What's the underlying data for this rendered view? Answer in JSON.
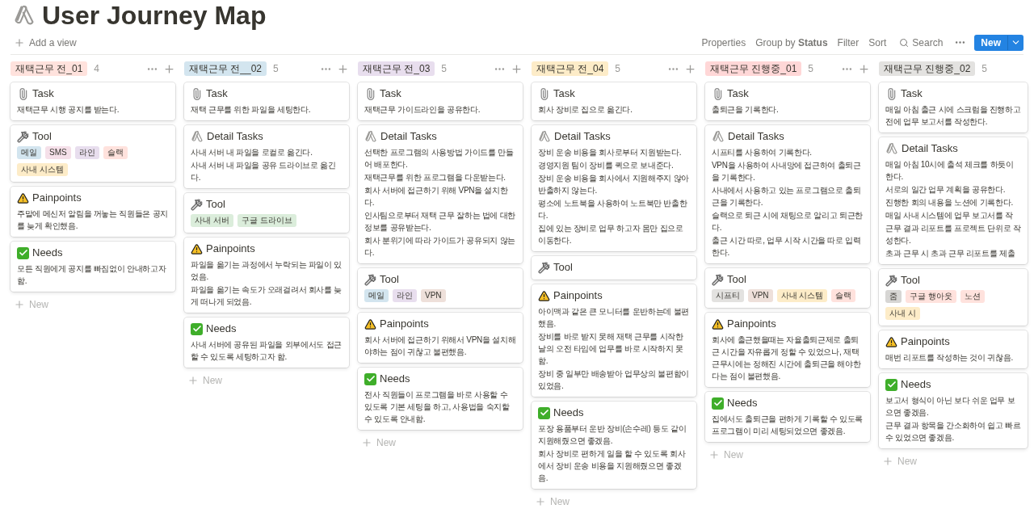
{
  "page": {
    "title": "User Journey Map"
  },
  "toolbar": {
    "add_view": "Add a view",
    "actions": [
      "Properties",
      "Group by **Status**",
      "Filter",
      "Sort"
    ],
    "search": "Search",
    "new_button": "New"
  },
  "columns": [
    {
      "label": "재택근무 전_01",
      "color": "#ffe2dd",
      "count": "4",
      "controls": true,
      "new_label": "New",
      "cards": [
        {
          "kind": "task",
          "heading": "Task",
          "lines": [
            "재택근무 시행 공지를 받는다."
          ]
        },
        {
          "kind": "tool",
          "heading": "Tool",
          "tags": [
            {
              "text": "메일",
              "color": "#d3e5ef"
            },
            {
              "text": "SMS",
              "color": "#f5e0e9"
            },
            {
              "text": "라인",
              "color": "#e8deee"
            },
            {
              "text": "슬랙",
              "color": "#ffe2dd"
            },
            {
              "text": "사내 시스템",
              "color": "#fdecc8"
            }
          ]
        },
        {
          "kind": "painpoints",
          "heading": "Painpoints",
          "lines": [
            "주말에 메신저 알림을 꺼놓는 직원들은 공지를 늦게 확인했음."
          ]
        },
        {
          "kind": "needs",
          "heading": "Needs",
          "lines": [
            "모든 직원에게 공지를 빠짐없이 안내하고자 함."
          ]
        }
      ]
    },
    {
      "label": "재택근무 전__02",
      "color": "#d3e5ef",
      "count": "5",
      "controls": true,
      "new_label": "New",
      "cards": [
        {
          "kind": "task",
          "heading": "Task",
          "lines": [
            "재택 근무를 위한 파일을 세팅한다."
          ]
        },
        {
          "kind": "detail",
          "heading": "Detail Tasks",
          "lines": [
            "사내 서버 내 파일을 로컬로 옮긴다.",
            "사내 서버 내 파일을 공유 드라이브로 옮긴다."
          ]
        },
        {
          "kind": "tool",
          "heading": "Tool",
          "tags": [
            {
              "text": "사내 서버",
              "color": "#dbeddb"
            },
            {
              "text": "구글 드라이브",
              "color": "#dbeddb"
            }
          ]
        },
        {
          "kind": "painpoints",
          "heading": "Painpoints",
          "lines": [
            "파일을 옮기는 과정에서 누락되는 파일이 있었음.",
            "파일을 옮기는 속도가 오래걸려서 회사를 늦게 떠나게 되었음."
          ]
        },
        {
          "kind": "needs",
          "heading": "Needs",
          "lines": [
            "사내 서버에 공유된 파일을 외부에서도 접근할 수 있도록 세팅하고자 함."
          ]
        }
      ]
    },
    {
      "label": "재택근무 전_03",
      "color": "#e8deee",
      "count": "5",
      "controls": true,
      "new_label": "New",
      "cards": [
        {
          "kind": "task",
          "heading": "Task",
          "lines": [
            "재택근무 가이드라인을 공유한다."
          ]
        },
        {
          "kind": "detail",
          "heading": "Detail Tasks",
          "lines": [
            "선택한 프로그램의 사용방법 가이드를 만들어 배포한다.",
            "재택근무를 위한 프로그램을 다운받는다.",
            "회사 서버에 접근하기 위해 VPN을 설치한다.",
            "인사팀으로부터 재택 근무 잘하는 법에 대한 정보를 공유받는다.",
            "회사 분위기에 따라 가이드가 공유되지 않는다."
          ]
        },
        {
          "kind": "tool",
          "heading": "Tool",
          "tags": [
            {
              "text": "메일",
              "color": "#d3e5ef"
            },
            {
              "text": "라인",
              "color": "#e8deee"
            },
            {
              "text": "VPN",
              "color": "#eee0da"
            }
          ]
        },
        {
          "kind": "painpoints",
          "heading": "Painpoints",
          "lines": [
            "회사 서버에 접근하기 위해서 VPN을 설치해야하는 점이 귀찮고 불편했음."
          ]
        },
        {
          "kind": "needs",
          "heading": "Needs",
          "lines": [
            "전사 직원들이 프로그램을 바로 사용할 수 있도록 기본 세팅을 하고, 사용법을 숙지할 수 있도록 안내함."
          ]
        }
      ]
    },
    {
      "label": "재택근무 전_04",
      "color": "#fdecc8",
      "count": "5",
      "controls": true,
      "new_label": "New",
      "cards": [
        {
          "kind": "task",
          "heading": "Task",
          "lines": [
            "회사 장비로 집으로 옮긴다."
          ]
        },
        {
          "kind": "detail",
          "heading": "Detail Tasks",
          "lines": [
            "장비 운송 비용을 회사로부터 지원받는다.",
            "경영지원 팀이 장비를 퀵으로 보내준다.",
            "장비 운송 비용을 회사에서 지원해주지 않아 반출하지 않는다.",
            "평소에 노트북을 사용하여 노트북만 반출한다.",
            "집에 있는 장비로 업무 하고자 몸만 집으로 이동한다."
          ]
        },
        {
          "kind": "tool",
          "heading": "Tool"
        },
        {
          "kind": "painpoints",
          "heading": "Painpoints",
          "lines": [
            "아이맥과 같은 큰 모니터를 운반하는데 불편했음.",
            "장비를 바로 받지 못해 재택 근무를 시작한 날의 오전 타임에 업무를 바로 시작하지 못함.",
            "장비 중 일부만 배송받아 업무상의 불편함이 있었음."
          ]
        },
        {
          "kind": "needs",
          "heading": "Needs",
          "lines": [
            "포장 용품부터 운반 장비(손수레) 등도 같이 지원해줬으면 좋겠음.",
            "회사 장비로 편하게 일을 할 수 있도록 회사에서 장비 운송 비용을 지원해줬으면 좋겠음."
          ]
        }
      ]
    },
    {
      "label": "재택근무 진행중_01",
      "color": "#ffd7d7",
      "count": "5",
      "controls": true,
      "new_label": "New",
      "cards": [
        {
          "kind": "task",
          "heading": "Task",
          "lines": [
            "출퇴근을 기록한다."
          ]
        },
        {
          "kind": "detail",
          "heading": "Detail Tasks",
          "lines": [
            "시프티를 사용하여 기록한다.",
            "VPN을 사용하여 사내망에 접근하여 출퇴근을 기록한다.",
            "사내에서 사용하고 있는 프로그램으로 출퇴근을 기록한다.",
            "슬랙으로 퇴근 시에 채팅으로 알리고 퇴근한다.",
            "출근 시간 따로, 업무 시작 시간을 따로 입력한다."
          ]
        },
        {
          "kind": "tool",
          "heading": "Tool",
          "tags": [
            {
              "text": "시프티",
              "color": "#e3e2e0"
            },
            {
              "text": "VPN",
              "color": "#eee0da"
            },
            {
              "text": "사내 시스템",
              "color": "#fdecc8"
            },
            {
              "text": "슬랙",
              "color": "#ffe2dd"
            }
          ]
        },
        {
          "kind": "painpoints",
          "heading": "Painpoints",
          "lines": [
            "회사에 출근했을때는 자율출퇴근제로 출퇴근 시간을 자유롭게 정할 수 있었으나, 재택근무시에는 정해진 시간에 출퇴근을 해야한다는 점이 불편했음."
          ]
        },
        {
          "kind": "needs",
          "heading": "Needs",
          "lines": [
            "집에서도 출퇴근을 편하게 기록할 수 있도록 프로그램이 미리 세팅되었으면 좋겠음."
          ]
        }
      ]
    },
    {
      "label": "재택근무 진행중_02",
      "color": "#e3e2e0",
      "count": "5",
      "controls": false,
      "new_label": "New",
      "cards": [
        {
          "kind": "task",
          "heading": "Task",
          "lines": [
            "매일 아침 출근 시에 스크럼을 진행하고 전에 업무 보고서를 작성한다."
          ]
        },
        {
          "kind": "detail",
          "heading": "Detail Tasks",
          "lines": [
            "매일 아침 10시에 출석 체크를 하듯이 한다.",
            "서로의 일간 업무 계획을 공유한다.",
            "진행한 회의 내용을 노션에 기록한다.",
            "매일 사내 시스템에 업무 보고서를 작",
            "근무 결과 리포트를 프로젝트 단위로 작성한다.",
            "초과 근무 시 초과 근무 리포트를 제출"
          ]
        },
        {
          "kind": "tool",
          "heading": "Tool",
          "tags": [
            {
              "text": "줌",
              "color": "#d7d6d4"
            },
            {
              "text": "구글 행아웃",
              "color": "#ffe2dd"
            },
            {
              "text": "노션",
              "color": "#ffe2dd"
            },
            {
              "text": "사내 시",
              "color": "#fdecc8"
            }
          ]
        },
        {
          "kind": "painpoints",
          "heading": "Painpoints",
          "lines": [
            "매번 리포트를 작성하는 것이 귀찮음."
          ]
        },
        {
          "kind": "needs",
          "heading": "Needs",
          "lines": [
            "보고서 형식이 아닌 보다 쉬운 업무 보 으면 좋겠음.",
            "근무 결과 항목을 간소화하여 쉽고 빠르 수 있었으면 좋겠음."
          ]
        }
      ]
    }
  ]
}
